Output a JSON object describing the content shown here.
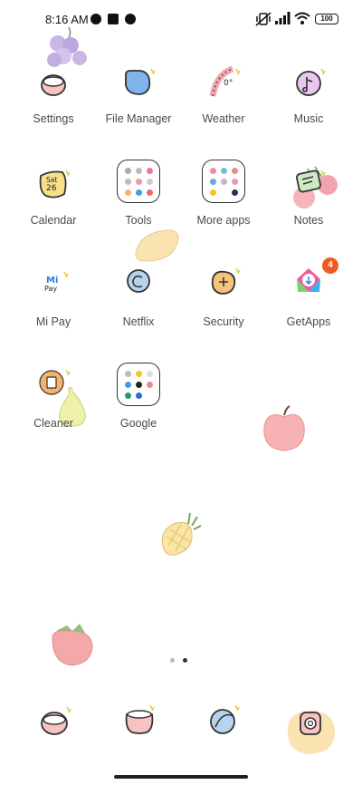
{
  "status_bar": {
    "time": "8:16 AM",
    "battery": "100",
    "icons": [
      "notification-icon",
      "square-icon",
      "notification-icon",
      "vibrate-icon",
      "signal-icon",
      "wifi-icon",
      "battery-icon"
    ]
  },
  "apps": [
    {
      "label": "Settings",
      "icon": "settings-icon"
    },
    {
      "label": "File Manager",
      "icon": "file-manager-icon"
    },
    {
      "label": "Weather",
      "icon": "weather-icon",
      "icon_text": "0°"
    },
    {
      "label": "Music",
      "icon": "music-icon"
    },
    {
      "label": "Calendar",
      "icon": "calendar-icon",
      "icon_text_1": "Sat",
      "icon_text_2": "26"
    },
    {
      "label": "Tools",
      "icon": "folder-icon"
    },
    {
      "label": "More apps",
      "icon": "folder-icon"
    },
    {
      "label": "Notes",
      "icon": "notes-icon"
    },
    {
      "label": "Mi Pay",
      "icon": "mi-pay-icon",
      "icon_text_1": "Mi",
      "icon_text_2": "Pay"
    },
    {
      "label": "Netflix",
      "icon": "netflix-icon"
    },
    {
      "label": "Security",
      "icon": "security-icon"
    },
    {
      "label": "GetApps",
      "icon": "getapps-icon",
      "badge": "4"
    },
    {
      "label": "Cleaner",
      "icon": "cleaner-icon"
    },
    {
      "label": "Google",
      "icon": "folder-icon"
    }
  ],
  "dock": [
    {
      "name": "phone-icon"
    },
    {
      "name": "messages-icon"
    },
    {
      "name": "browser-icon"
    },
    {
      "name": "camera-icon"
    }
  ],
  "pager": {
    "pages": 2,
    "current": 2
  },
  "colors": {
    "background": "#ffffff",
    "label": "#4a4a4a",
    "badge": "#f15a24",
    "accent_blue": "#7fb4ea",
    "accent_pink": "#f4a6b0",
    "accent_orange": "#f7b36a"
  }
}
